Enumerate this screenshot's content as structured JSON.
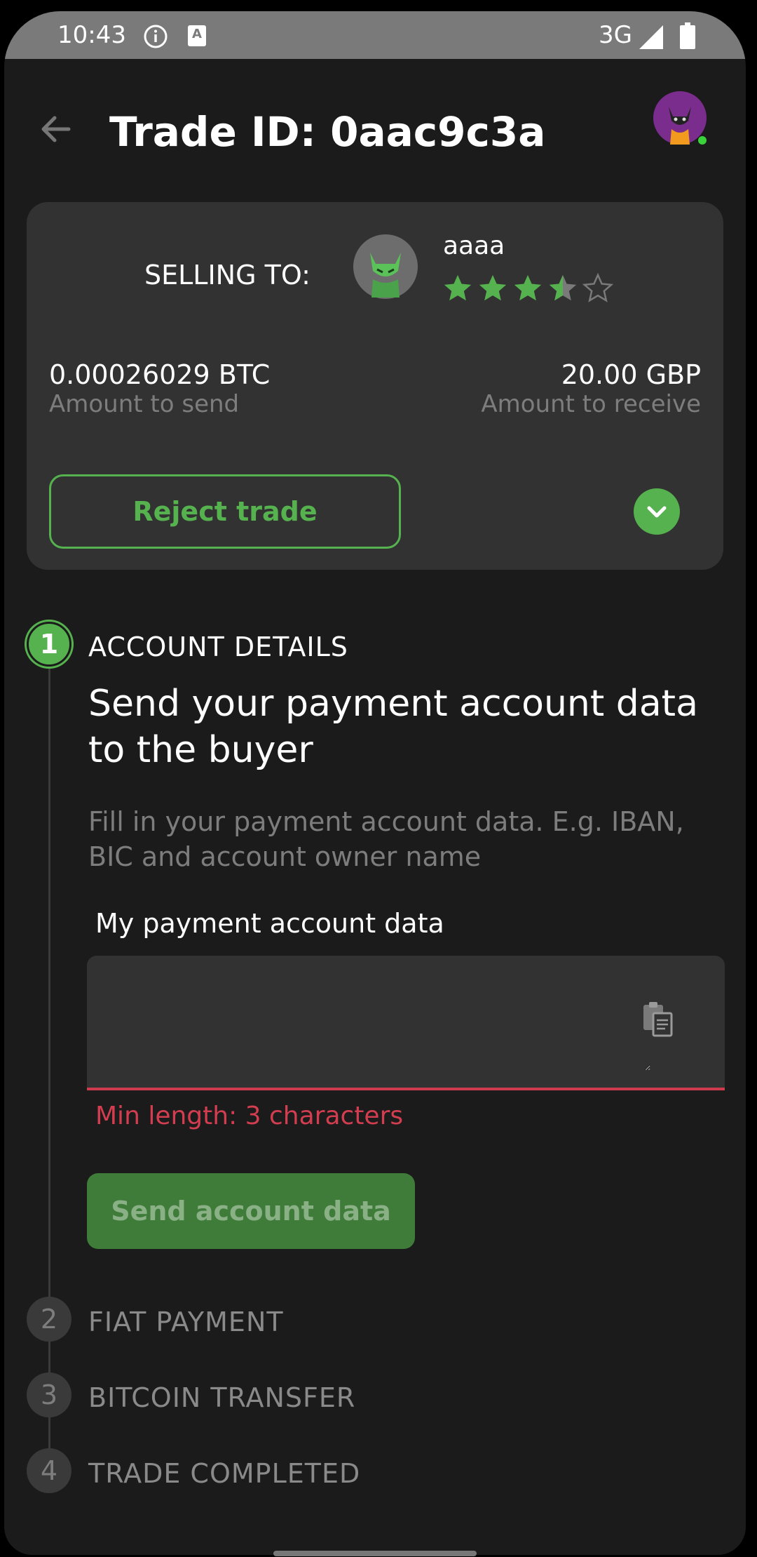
{
  "status_bar": {
    "time": "10:43",
    "network": "3G",
    "info_icon": "info-circle-icon",
    "notification_icon": "a-badge-icon",
    "signal_icon": "signal-icon",
    "battery_icon": "battery-icon"
  },
  "header": {
    "back_icon": "arrow-left-icon",
    "title": "Trade ID: 0aac9c3a",
    "avatar_icon": "user-avatar-icon"
  },
  "summary": {
    "selling_label": "SELLING TO:",
    "peer_name": "aaaa",
    "rating": 3.5,
    "rating_max": 5,
    "amount_send": "0.00026029 BTC",
    "amount_send_caption": "Amount to send",
    "amount_receive": "20.00 GBP",
    "amount_receive_caption": "Amount to receive",
    "reject_label": "Reject trade",
    "expand_icon": "chevron-down-icon"
  },
  "steps": [
    {
      "number": "1",
      "label": "ACCOUNT DETAILS",
      "active": true
    },
    {
      "number": "2",
      "label": "FIAT PAYMENT",
      "active": false
    },
    {
      "number": "3",
      "label": "BITCOIN TRANSFER",
      "active": false
    },
    {
      "number": "4",
      "label": "TRADE COMPLETED",
      "active": false
    }
  ],
  "account_step": {
    "heading": "Send your payment account data to the buyer",
    "description": "Fill in your payment account data. E.g. IBAN, BIC and account owner name",
    "field_label": "My payment account data",
    "field_value": "",
    "paste_icon": "clipboard-paste-icon",
    "error": "Min length: 3 characters",
    "submit_label": "Send account data"
  },
  "colors": {
    "accent": "#55b24e",
    "error": "#d23d50",
    "background": "#1b1b1b",
    "card": "#323232"
  }
}
